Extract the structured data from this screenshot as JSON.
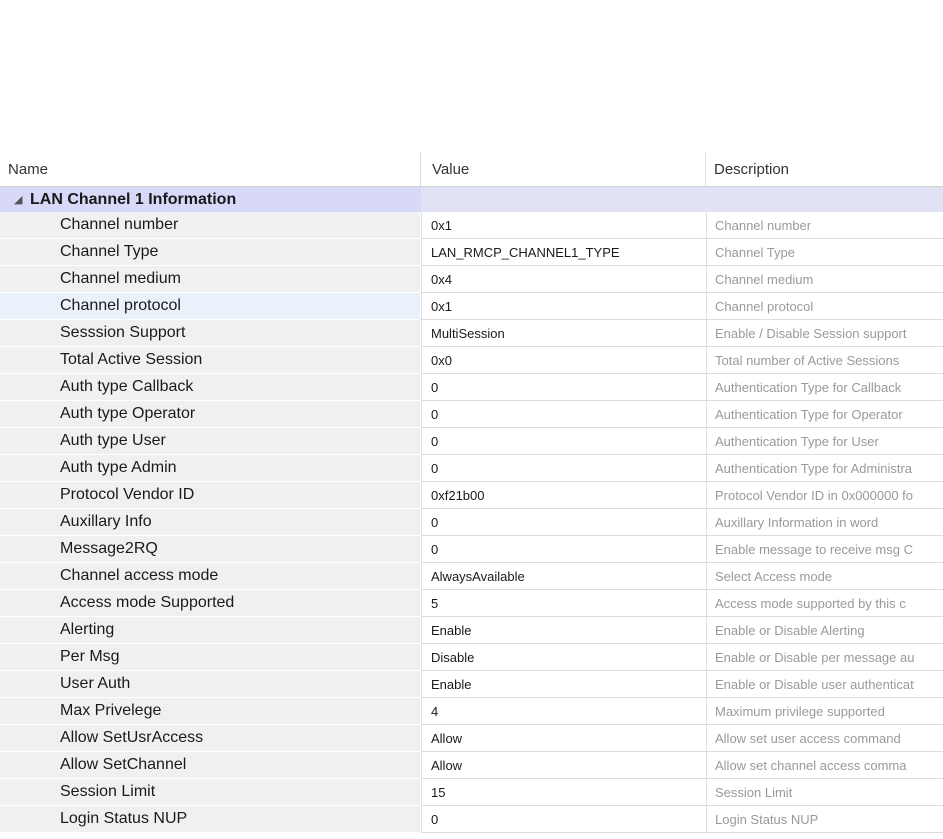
{
  "columns": {
    "name": "Name",
    "value": "Value",
    "description": "Description"
  },
  "group": {
    "title": "LAN Channel 1 Information",
    "expanded": true
  },
  "rows": [
    {
      "name": "Channel number",
      "value": "0x1",
      "description": "Channel number"
    },
    {
      "name": "Channel Type",
      "value": "LAN_RMCP_CHANNEL1_TYPE",
      "description": "Channel Type"
    },
    {
      "name": "Channel medium",
      "value": "0x4",
      "description": "Channel medium"
    },
    {
      "name": "Channel protocol",
      "value": "0x1",
      "description": "Channel protocol",
      "highlighted": true
    },
    {
      "name": "Sesssion Support",
      "value": "MultiSession",
      "description": "Enable / Disable Session support"
    },
    {
      "name": "Total Active Session",
      "value": "0x0",
      "description": "Total number of Active Sessions"
    },
    {
      "name": "Auth type Callback",
      "value": "0",
      "description": "Authentication Type for Callback"
    },
    {
      "name": "Auth type Operator",
      "value": "0",
      "description": "Authentication Type for Operator"
    },
    {
      "name": "Auth type User",
      "value": "0",
      "description": "Authentication Type for User"
    },
    {
      "name": "Auth type Admin",
      "value": "0",
      "description": "Authentication Type for Administra"
    },
    {
      "name": "Protocol Vendor ID",
      "value": "0xf21b00",
      "description": "Protocol Vendor ID in 0x000000 fo"
    },
    {
      "name": "Auxillary Info",
      "value": "0",
      "description": "Auxillary Information in word"
    },
    {
      "name": "Message2RQ",
      "value": "0",
      "description": "Enable message to receive msg C"
    },
    {
      "name": "Channel access mode",
      "value": "AlwaysAvailable",
      "description": "Select Access mode"
    },
    {
      "name": "Access mode Supported",
      "value": "5",
      "description": "Access mode supported by this c"
    },
    {
      "name": "Alerting",
      "value": "Enable",
      "description": "Enable or Disable Alerting"
    },
    {
      "name": "Per Msg",
      "value": "Disable",
      "description": "Enable or Disable per message au"
    },
    {
      "name": "User Auth",
      "value": "Enable",
      "description": "Enable or Disable user authenticat"
    },
    {
      "name": "Max Privelege",
      "value": "4",
      "description": "Maximum privilege supported"
    },
    {
      "name": "Allow SetUsrAccess",
      "value": "Allow",
      "description": "Allow set user access command"
    },
    {
      "name": "Allow SetChannel",
      "value": "Allow",
      "description": "Allow set channel access comma"
    },
    {
      "name": "Session Limit",
      "value": "15",
      "description": "Session Limit"
    },
    {
      "name": "Login Status NUP",
      "value": "0",
      "description": "Login Status NUP"
    }
  ]
}
